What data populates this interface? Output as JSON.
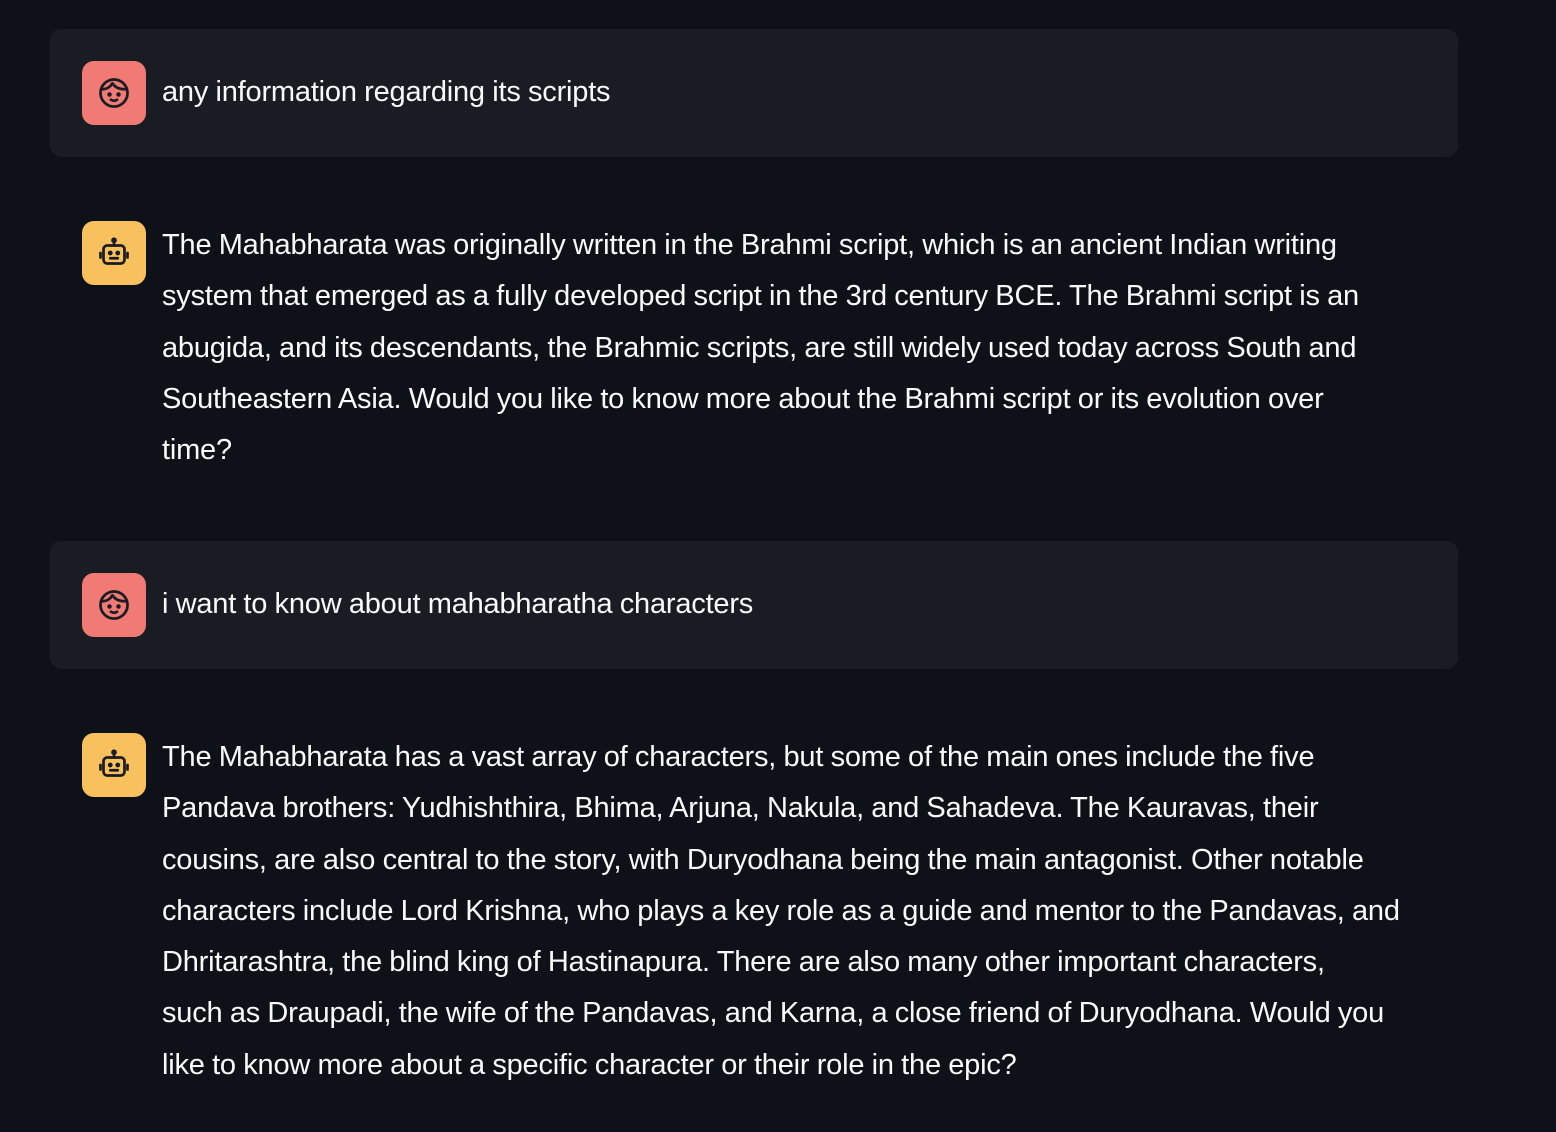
{
  "messages": [
    {
      "role": "user",
      "avatar_icon": "user-face-icon",
      "lines": [
        "any information regarding its scripts"
      ]
    },
    {
      "role": "assistant",
      "avatar_icon": "robot-face-icon",
      "lines": [
        "The Mahabharata was originally written in the Brahmi script, which is an ancient Indian writing",
        "system that emerged as a fully developed script in the 3rd century BCE. The Brahmi script is an",
        "abugida, and its descendants, the Brahmic scripts, are still widely used today across South and",
        "Southeastern Asia. Would you like to know more about the Brahmi script or its evolution over",
        "time?"
      ]
    },
    {
      "role": "user",
      "avatar_icon": "user-face-icon",
      "lines": [
        "i want to know about mahabharatha characters"
      ]
    },
    {
      "role": "assistant",
      "avatar_icon": "robot-face-icon",
      "lines": [
        "The Mahabharata has a vast array of characters, but some of the main ones include the five",
        "Pandava brothers: Yudhishthira, Bhima, Arjuna, Nakula, and Sahadeva. The Kauravas, their",
        "cousins, are also central to the story, with Duryodhana being the main antagonist. Other notable",
        "characters include Lord Krishna, who plays a key role as a guide and mentor to the Pandavas, and",
        "Dhritarashtra, the blind king of Hastinapura. There are also many other important characters,",
        "such as Draupadi, the wife of the Pandavas, and Karna, a close friend of Duryodhana. Would you",
        "like to know more about a specific character or their role in the epic?"
      ]
    }
  ],
  "colors": {
    "background": "#0e1117",
    "user_bubble": "#1a1c24",
    "user_avatar": "#f17b74",
    "assistant_avatar": "#f8c15d",
    "text": "#fafafa"
  }
}
